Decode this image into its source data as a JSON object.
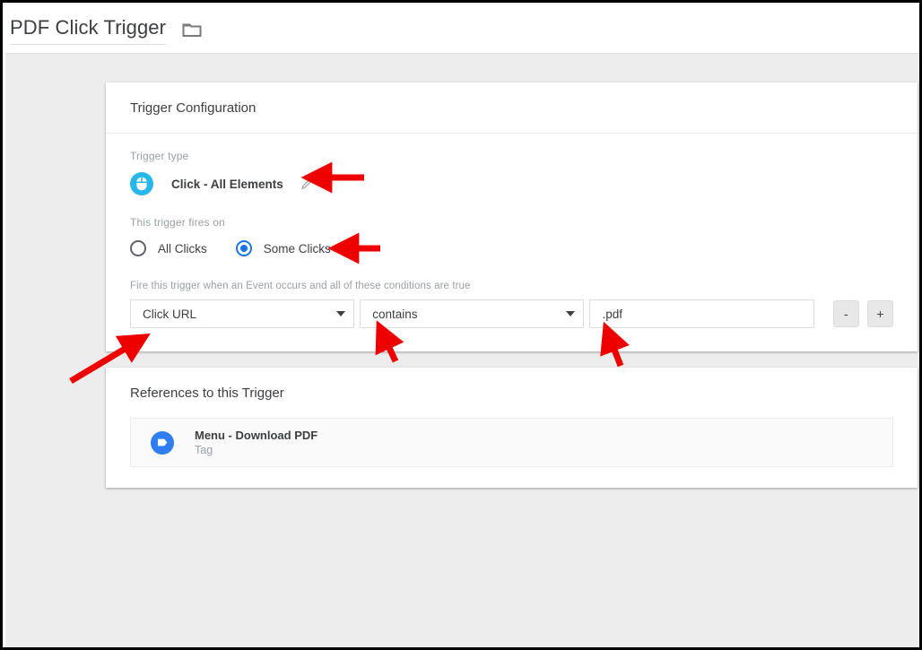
{
  "window": {
    "title": "PDF Click Trigger",
    "folder_icon": "folder-icon"
  },
  "config_card": {
    "header": "Trigger Configuration",
    "trigger_type": {
      "label": "Trigger type",
      "value": "Click - All Elements",
      "icon": "mouse-click-icon",
      "edit_icon": "pencil-edit-icon"
    },
    "fires_on": {
      "label": "This trigger fires on",
      "options": [
        {
          "label": "All Clicks",
          "selected": false
        },
        {
          "label": "Some Clicks",
          "selected": true
        }
      ]
    },
    "conditions": {
      "hint": "Fire this trigger when an Event occurs and all of these conditions are true",
      "variable": "Click URL",
      "operator": "contains",
      "value": ".pdf",
      "remove_label": "-",
      "add_label": "+"
    }
  },
  "references_card": {
    "header": "References to this Trigger",
    "items": [
      {
        "name": "Menu - Download PDF",
        "type": "Tag",
        "icon": "tag-icon"
      }
    ]
  },
  "annotations": {
    "accent_color": "#ee0000",
    "arrows": [
      {
        "name": "arrow-to-trigger-type",
        "target": "Click - All Elements"
      },
      {
        "name": "arrow-to-some-clicks",
        "target": "Some Clicks"
      },
      {
        "name": "arrow-to-click-url-select",
        "target": "Click URL"
      },
      {
        "name": "arrow-to-operator-select",
        "target": "contains"
      },
      {
        "name": "arrow-to-value-input",
        "target": ".pdf"
      }
    ]
  }
}
